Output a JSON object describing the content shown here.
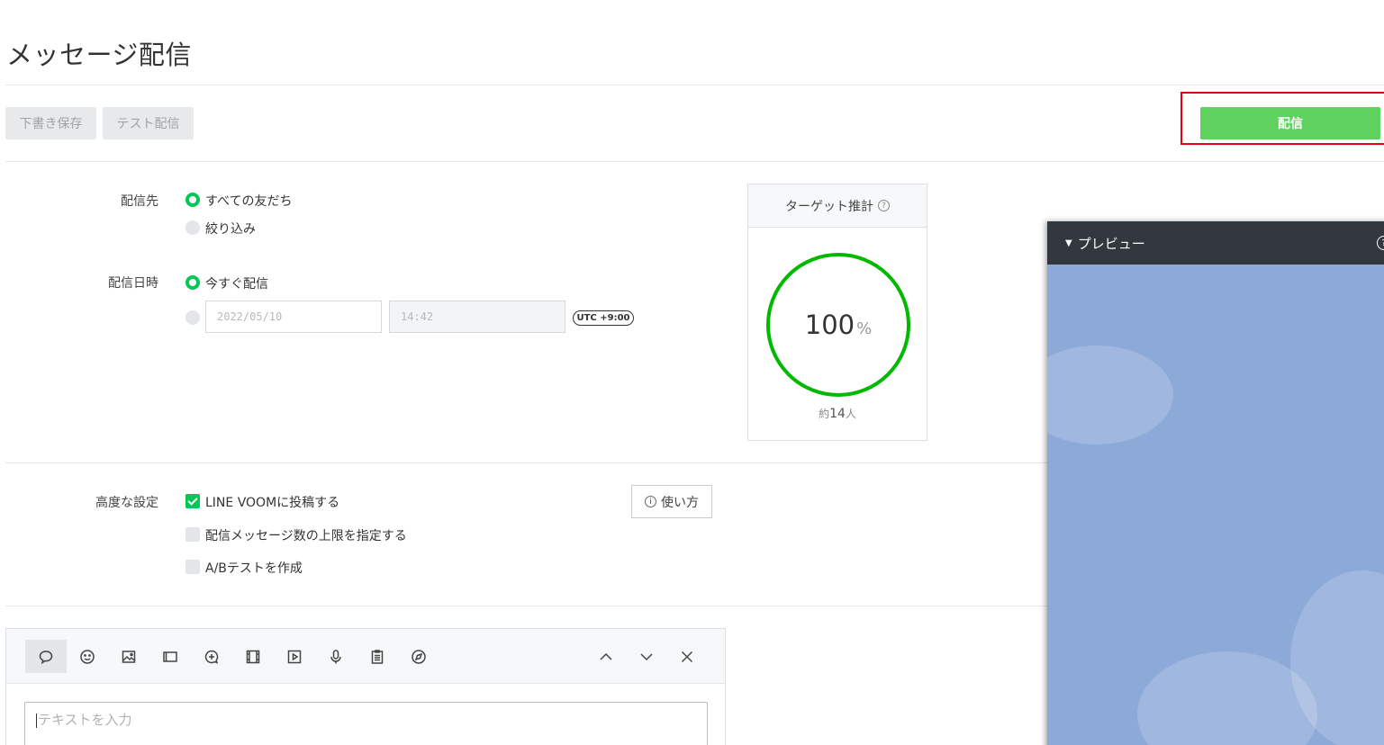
{
  "page": {
    "title": "メッセージ配信"
  },
  "toolbar": {
    "draft_label": "下書き保存",
    "test_label": "テスト配信",
    "send_label": "配信"
  },
  "recipients": {
    "label": "配信先",
    "options": [
      "すべての友だち",
      "絞り込み"
    ],
    "selected": "すべての友だち"
  },
  "schedule": {
    "label": "配信日時",
    "now_label": "今すぐ配信",
    "date_value": "2022/05/10",
    "time_value": "14:42",
    "timezone": "UTC +9:00"
  },
  "target": {
    "title": "ターゲット推計",
    "help_glyph": "?",
    "percent": "100",
    "percent_sign": "%",
    "people_prefix": "約",
    "people_count": "14",
    "people_suffix": "人"
  },
  "advanced": {
    "label": "高度な設定",
    "options": [
      {
        "label": "LINE VOOMに投稿する",
        "checked": true
      },
      {
        "label": "配信メッセージ数の上限を指定する",
        "checked": false
      },
      {
        "label": "A/Bテストを作成",
        "checked": false
      }
    ],
    "howto_label": "使い方",
    "howto_icon": "i"
  },
  "editor": {
    "tools": [
      "speech-bubble-icon",
      "emoji-icon",
      "image-icon",
      "card-icon",
      "add-bubble-icon",
      "video-icon",
      "play-icon",
      "mic-icon",
      "clipboard-icon",
      "compass-icon"
    ],
    "placeholder": "テキストを入力"
  },
  "preview": {
    "title": "プレビュー",
    "toggle_glyph": "▼",
    "help_glyph": "?"
  },
  "colors": {
    "accent_green": "#06c755",
    "send_button": "#5fd15f",
    "highlight_border": "#e60012",
    "preview_bg": "#8ca9d8"
  }
}
